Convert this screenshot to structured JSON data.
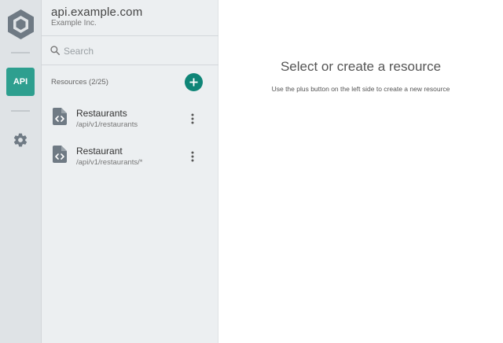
{
  "workspace": {
    "title": "api.example.com",
    "subtitle": "Example Inc."
  },
  "rail": {
    "logo_icon": "hexagon-logo-icon",
    "api_label": "API",
    "settings_icon": "gear-icon",
    "accent_color": "#2e9f8f"
  },
  "search": {
    "placeholder": "Search",
    "value": ""
  },
  "resources": {
    "header": "Resources (2/25)",
    "add_color": "#0f8577",
    "items": [
      {
        "name": "Restaurants",
        "path": "/api/v1/restaurants",
        "icon": "code-file-icon"
      },
      {
        "name": "Restaurant",
        "path": "/api/v1/restaurants/*",
        "icon": "code-file-icon"
      }
    ]
  },
  "main": {
    "empty_title": "Select or create a resource",
    "empty_hint": "Use the plus button on the left side to create a new resource"
  }
}
